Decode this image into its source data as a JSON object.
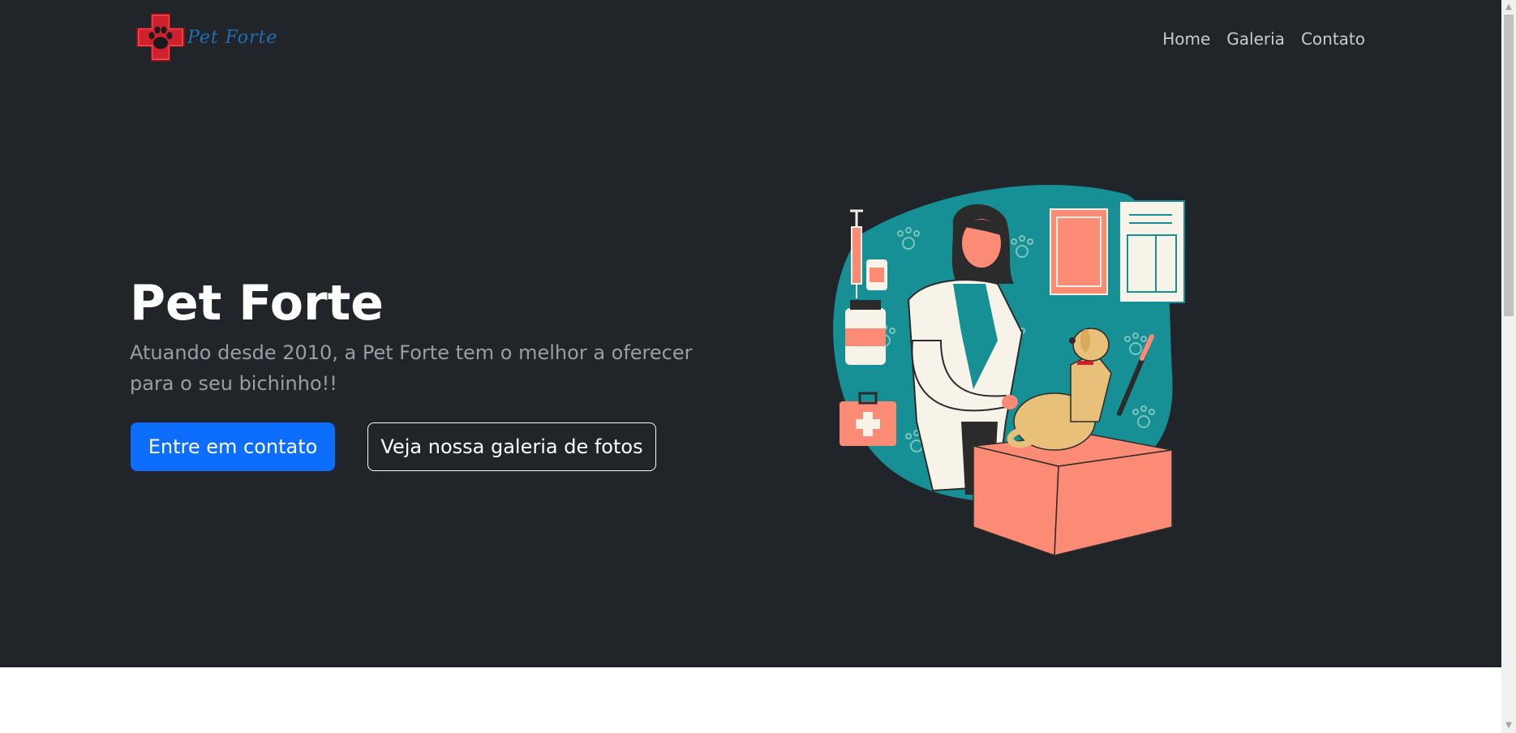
{
  "brand": {
    "name": "Pet Forte"
  },
  "nav": {
    "items": [
      {
        "label": "Home"
      },
      {
        "label": "Galeria"
      },
      {
        "label": "Contato"
      }
    ]
  },
  "hero": {
    "title": "Pet Forte",
    "lead": "Atuando desde 2010, a Pet Forte tem o melhor a oferecer para o seu bichinho!!",
    "primary_button": "Entre em contato",
    "secondary_button": "Veja nossa galeria de fotos",
    "illustration_icon": "vet-with-dog-illustration"
  },
  "colors": {
    "hero_bg": "#212529",
    "primary": "#0d6efd",
    "brand_red": "#d0202e",
    "brand_blue": "#1f6fb2",
    "teal": "#168f95",
    "salmon": "#fb8b74"
  },
  "scrollbar": {
    "up_icon": "chevron-up-icon",
    "down_icon": "chevron-down-icon"
  }
}
